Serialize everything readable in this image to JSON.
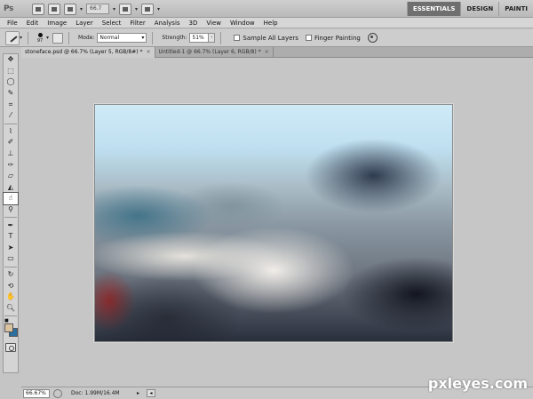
{
  "app": {
    "logo": "Ps",
    "zoom_value": "66.7"
  },
  "workspaces": [
    "ESSENTIALS",
    "DESIGN",
    "PAINTI"
  ],
  "menu": [
    "File",
    "Edit",
    "Image",
    "Layer",
    "Select",
    "Filter",
    "Analysis",
    "3D",
    "View",
    "Window",
    "Help"
  ],
  "options": {
    "brush_size": "97",
    "mode_label": "Mode:",
    "mode_value": "Normal",
    "strength_label": "Strength:",
    "strength_value": "51%",
    "sample_all_layers": "Sample All Layers",
    "finger_painting": "Finger Painting"
  },
  "tabs": [
    {
      "label": "stoneface.psd @ 66.7% (Layer 5, RGB/8#) *",
      "active": true
    },
    {
      "label": "Untitled-1 @ 66.7% (Layer 6, RGB/8) *",
      "active": false
    }
  ],
  "tools": [
    "move-tool",
    "marquee-tool",
    "lasso-tool",
    "quick-select-tool",
    "crop-tool",
    "eyedropper-tool",
    "spot-healing-tool",
    "brush-tool",
    "clone-stamp-tool",
    "history-brush-tool",
    "eraser-tool",
    "gradient-tool",
    "smudge-tool",
    "dodge-tool",
    "pen-tool",
    "type-tool",
    "path-select-tool",
    "rectangle-tool",
    "3d-rotate-tool",
    "3d-orbit-tool",
    "hand-tool",
    "zoom-tool"
  ],
  "colors": {
    "foreground": "#d8c2a0",
    "background": "#2a6fa0"
  },
  "status": {
    "zoom": "66.67%",
    "doc_info": "Doc: 1.99M/16.4M"
  },
  "watermark": "pxleyes.com"
}
